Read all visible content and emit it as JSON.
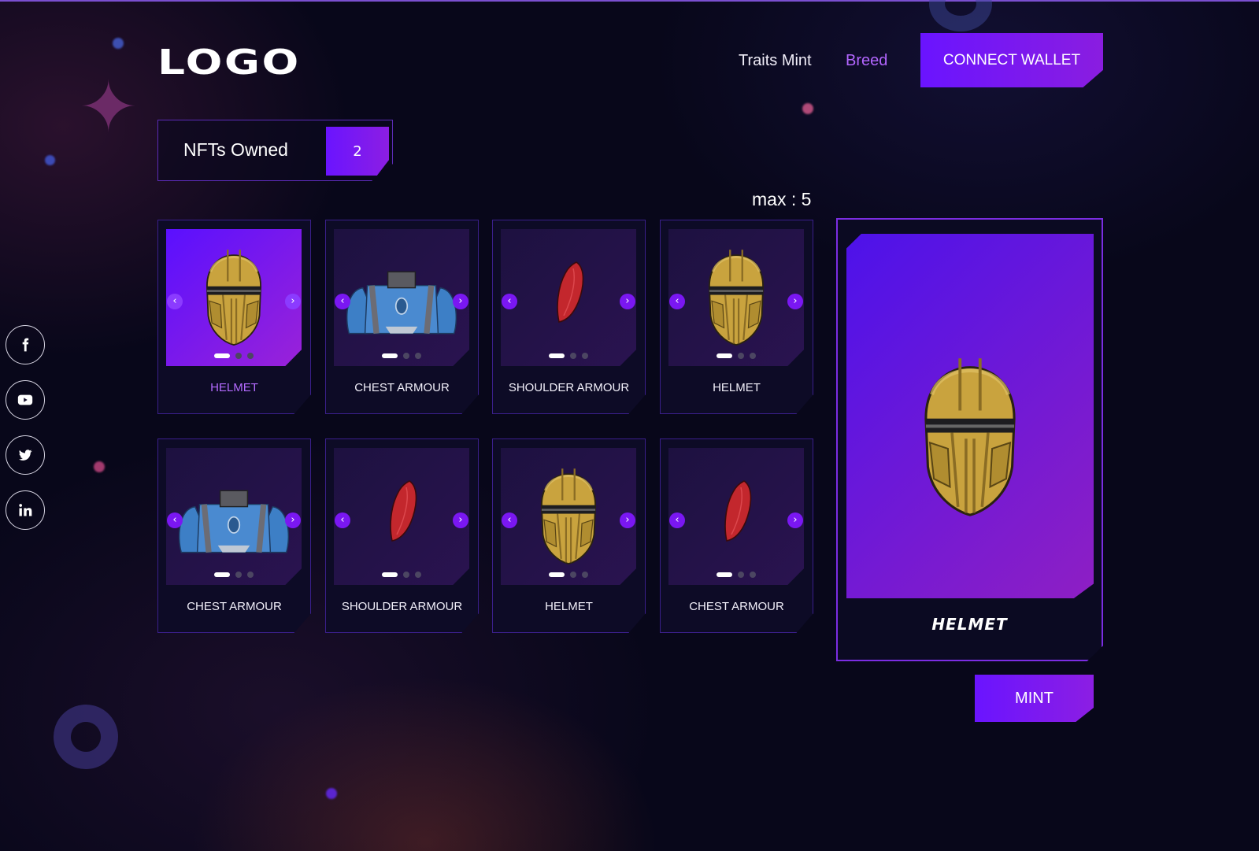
{
  "header": {
    "logo": "LOGO",
    "nav": [
      {
        "label": "Traits Mint"
      },
      {
        "label": "Breed"
      }
    ],
    "connect_wallet": "CONNECT WALLET"
  },
  "owned": {
    "label": "NFTs Owned",
    "count": "2",
    "max_label": "max : 5"
  },
  "cards": [
    {
      "label": "HELMET",
      "item": "helmet-icon",
      "active": true
    },
    {
      "label": "CHEST ARMOUR",
      "item": "chest-armour-icon",
      "active": false
    },
    {
      "label": "SHOULDER ARMOUR",
      "item": "shoulder-armour-icon",
      "active": false
    },
    {
      "label": "HELMET",
      "item": "helmet-icon",
      "active": false
    },
    {
      "label": "CHEST ARMOUR",
      "item": "chest-armour-icon",
      "active": false
    },
    {
      "label": "SHOULDER ARMOUR",
      "item": "shoulder-armour-icon",
      "active": false
    },
    {
      "label": "HELMET",
      "item": "helmet-icon",
      "active": false
    },
    {
      "label": "CHEST ARMOUR",
      "item": "shoulder-armour-icon",
      "active": false
    }
  ],
  "arrows": {
    "left": "‹",
    "right": "›"
  },
  "preview": {
    "title": "HELMET",
    "item": "helmet-icon"
  },
  "mint": "MINT",
  "socials": [
    {
      "name": "facebook-icon"
    },
    {
      "name": "youtube-icon"
    },
    {
      "name": "twitter-icon"
    },
    {
      "name": "linkedin-icon"
    }
  ],
  "colors": {
    "accent": "#7a17f2",
    "accent_light": "#b366ff",
    "background": "#08071a",
    "helmet_gold": "#c9a33e",
    "chest_blue": "#3d7fc6",
    "shoulder_red": "#c3272d"
  }
}
